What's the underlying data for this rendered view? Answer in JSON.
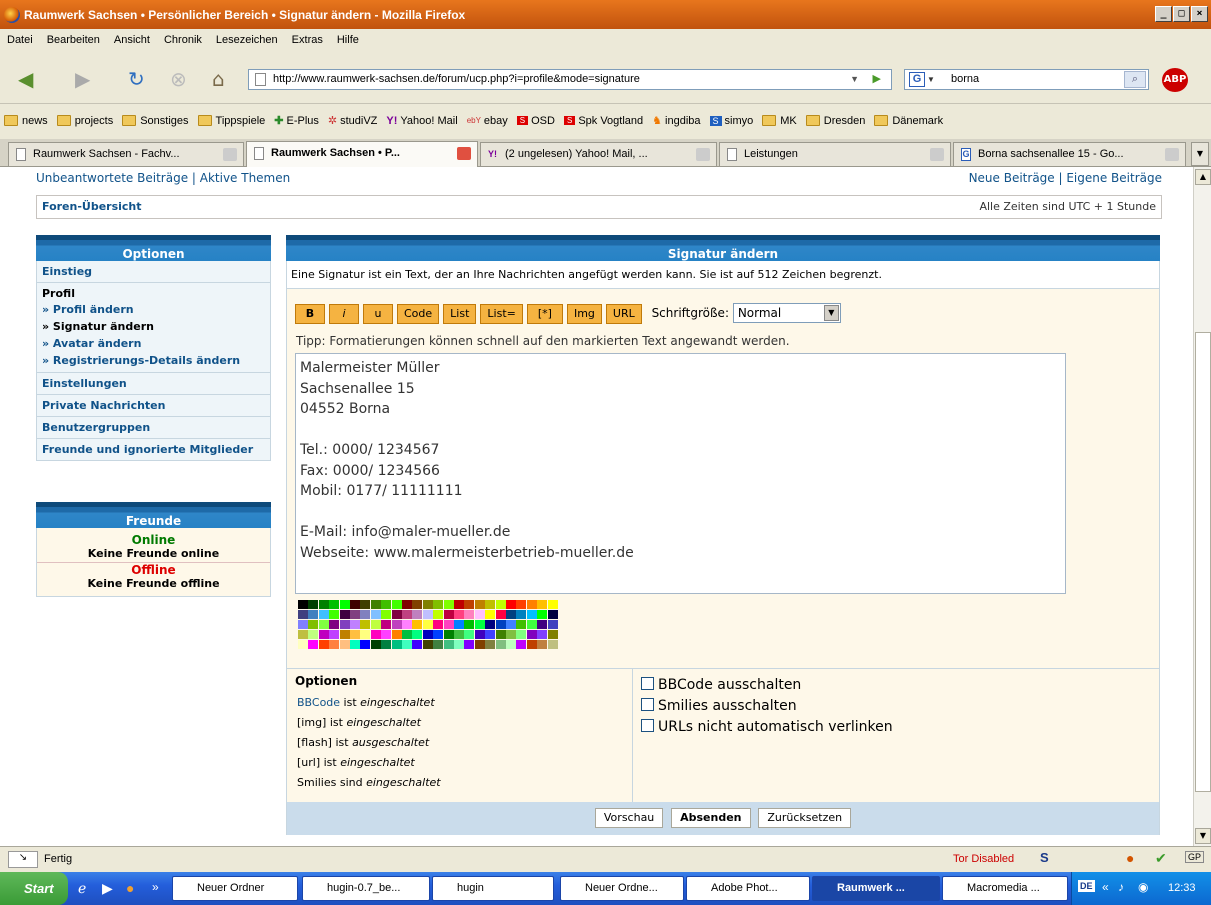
{
  "window": {
    "title": "Raumwerk Sachsen • Persönlicher Bereich • Signatur ändern - Mozilla Firefox",
    "min": "_",
    "max": "□",
    "close": "×"
  },
  "menu": [
    "Datei",
    "Bearbeiten",
    "Ansicht",
    "Chronik",
    "Lesezeichen",
    "Extras",
    "Hilfe"
  ],
  "nav": {
    "url": "http://www.raumwerk-sachsen.de/forum/ucp.php?i=profile&mode=signature",
    "search": "borna",
    "abp": "ABP"
  },
  "bookmarks": [
    {
      "label": "news",
      "icon": "folder-icon"
    },
    {
      "label": "projects",
      "icon": "folder-icon"
    },
    {
      "label": "Sonstiges",
      "icon": "folder-icon"
    },
    {
      "label": "Tippspiele",
      "icon": "folder-icon"
    },
    {
      "label": "E-Plus",
      "icon": "plus-icon"
    },
    {
      "label": "studiVZ",
      "icon": "studivz-icon"
    },
    {
      "label": "Yahoo! Mail",
      "icon": "yahoo-icon"
    },
    {
      "label": "ebay",
      "icon": "ebay-icon"
    },
    {
      "label": "OSD",
      "icon": "sparkasse-icon"
    },
    {
      "label": "Spk Vogtland",
      "icon": "sparkasse-icon"
    },
    {
      "label": "ingdiba",
      "icon": "ingdiba-icon"
    },
    {
      "label": "simyo",
      "icon": "simyo-icon"
    },
    {
      "label": "MK",
      "icon": "folder-icon"
    },
    {
      "label": "Dresden",
      "icon": "folder-icon"
    },
    {
      "label": "Dänemark",
      "icon": "folder-icon"
    }
  ],
  "tabs": [
    {
      "label": "Raumwerk Sachsen - Fachv..."
    },
    {
      "label": "Raumwerk Sachsen • P..."
    },
    {
      "label": "(2 ungelesen) Yahoo! Mail, ..."
    },
    {
      "label": "Leistungen"
    },
    {
      "label": "Borna sachsenallee 15 - Go..."
    }
  ],
  "page": {
    "top_left": "Unbeantwortete Beiträge | Aktive Themen",
    "top_right": "Neue Beiträge | Eigene Beiträge",
    "breadcrumb": "Foren-Übersicht",
    "timezone": "Alle Zeiten sind UTC + 1 Stunde"
  },
  "sidebar": {
    "title": "Optionen",
    "einstieg": "Einstieg",
    "profil": "Profil",
    "profil_items": [
      "» Profil ändern",
      "» Signatur ändern",
      "» Avatar ändern",
      "» Registrierungs-Details ändern"
    ],
    "items": [
      "Einstellungen",
      "Private Nachrichten",
      "Benutzergruppen",
      "Freunde und ignorierte Mitglieder"
    ]
  },
  "friends": {
    "title": "Freunde",
    "online": "Online",
    "online_text": "Keine Freunde online",
    "offline": "Offline",
    "offline_text": "Keine Freunde offline"
  },
  "main": {
    "title": "Signatur ändern",
    "info": "Eine Signatur ist ein Text, der an Ihre Nachrichten angefügt werden kann. Sie ist auf 512 Zeichen begrenzt.",
    "buttons": [
      "B",
      "i",
      "u",
      "Code",
      "List",
      "List=",
      "[*]",
      "Img",
      "URL"
    ],
    "font_label": "Schriftgröße:",
    "font_value": "Normal",
    "tip": "Tipp: Formatierungen können schnell auf den markierten Text angewandt werden.",
    "signature": [
      "Malermeister Müller",
      "Sachsenallee 15",
      "04552 Borna",
      "",
      "Tel.: 0000/ 1234567",
      "Fax: 0000/ 1234566",
      "Mobil: 0177/ 11111111",
      "",
      "E-Mail: info@maler-mueller.de",
      "Webseite: www.malermeisterbetrieb-mueller.de"
    ],
    "options_title": "Optionen",
    "opt_bbcode_link": "BBCode",
    "opt_status": [
      {
        "pre": " ist ",
        "val": "eingeschaltet"
      },
      {
        "pre": "[img] ist ",
        "val": "eingeschaltet"
      },
      {
        "pre": "[flash] ist ",
        "val": "ausgeschaltet"
      },
      {
        "pre": "[url] ist ",
        "val": "eingeschaltet"
      },
      {
        "pre": "Smilies sind ",
        "val": "eingeschaltet"
      }
    ],
    "checkboxes": [
      "BBCode ausschalten",
      "Smilies ausschalten",
      "URLs nicht automatisch verlinken"
    ],
    "preview": "Vorschau",
    "submit": "Absenden",
    "reset": "Zurücksetzen"
  },
  "status": {
    "text": "Fertig",
    "tor": "Tor Disabled"
  },
  "taskbar": {
    "start": "Start",
    "tasks": [
      "Neuer Ordner",
      "hugin-0.7_be...",
      "hugin",
      "Neuer Ordne...",
      "Adobe Phot...",
      "Raumwerk ...",
      "Macromedia ..."
    ],
    "clock": "12:33",
    "tray_lang": "DE"
  }
}
